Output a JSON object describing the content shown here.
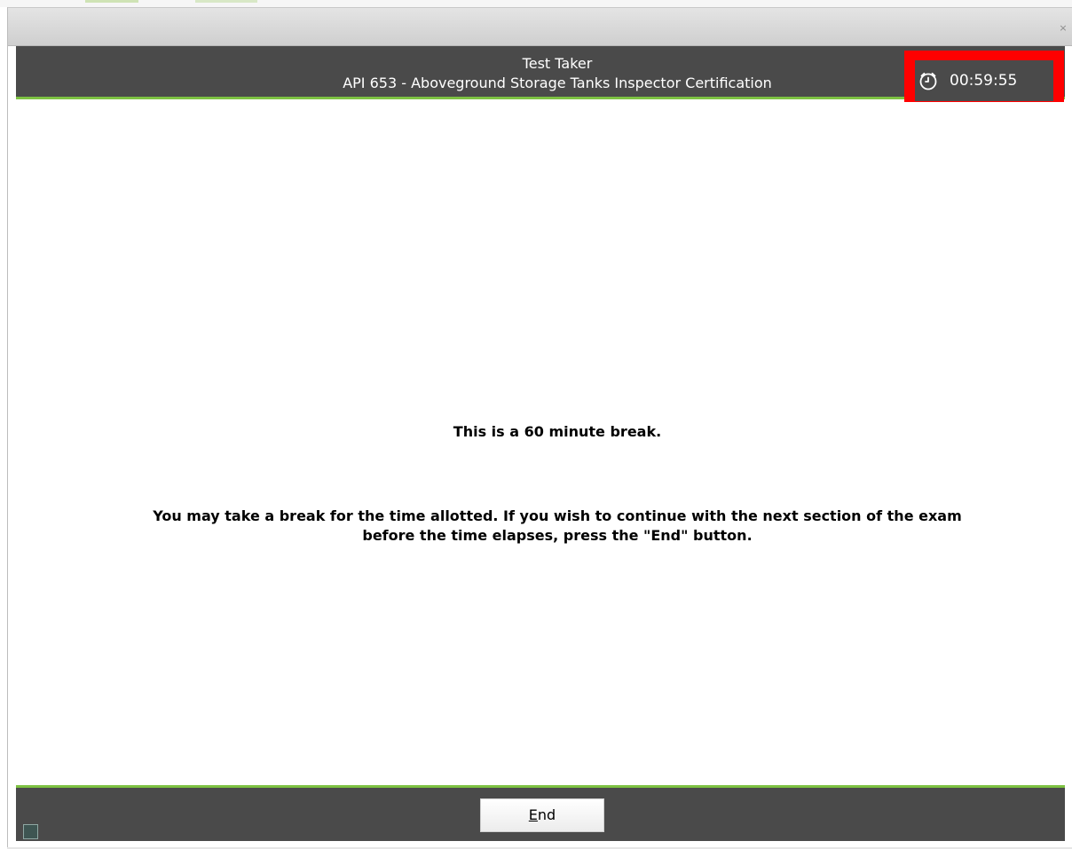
{
  "window": {
    "close_label": "×"
  },
  "header": {
    "candidate_name": "Test Taker",
    "exam_title": "API 653 - Aboveground Storage Tanks Inspector Certification"
  },
  "timer": {
    "icon": "alarm-clock-icon",
    "remaining": "00:59:55",
    "highlight_color": "#ff0000"
  },
  "content": {
    "heading": "This is a 60 minute break.",
    "instructions": "You may take a break for the time allotted. If you wish to continue with the next section of the exam before the time elapses, press the \"End\" button."
  },
  "footer": {
    "end_button_mnemonic": "E",
    "end_button_rest": "nd"
  },
  "colors": {
    "bar_background": "#4a4a4a",
    "accent_green": "#7dc242",
    "text_on_bar": "#ffffff"
  }
}
